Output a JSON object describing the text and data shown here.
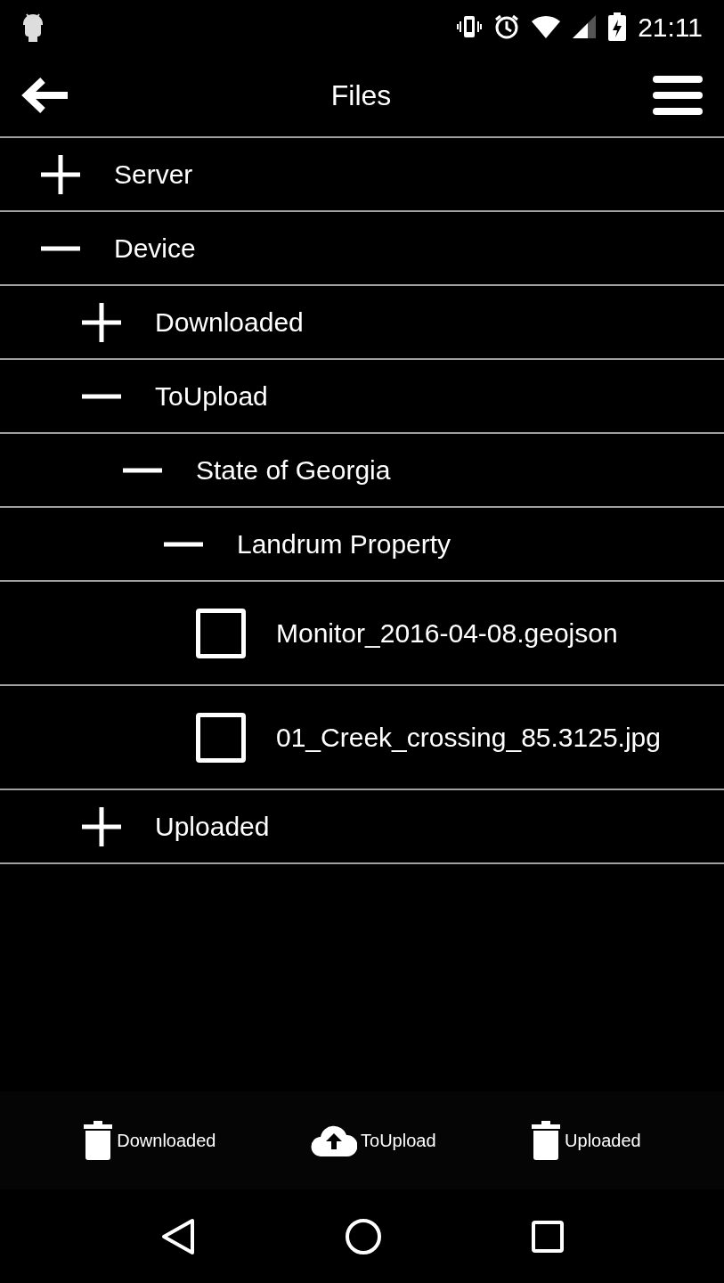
{
  "status_bar": {
    "time": "21:11"
  },
  "app_bar": {
    "title": "Files"
  },
  "tree": [
    {
      "label": "Server",
      "expanded": false
    },
    {
      "label": "Device",
      "expanded": true,
      "children": [
        {
          "label": "Downloaded",
          "expanded": false
        },
        {
          "label": "ToUpload",
          "expanded": true,
          "children": [
            {
              "label": "State of Georgia",
              "expanded": true,
              "children": [
                {
                  "label": "Landrum Property",
                  "expanded": true,
                  "children": [
                    {
                      "kind": "file",
                      "label": "Monitor_2016-04-08.geojson",
                      "checked": false
                    },
                    {
                      "kind": "file",
                      "label": "01_Creek_crossing_85.3125.jpg",
                      "checked": false
                    }
                  ]
                }
              ]
            }
          ]
        },
        {
          "label": "Uploaded",
          "expanded": false
        }
      ]
    }
  ],
  "toolbar": [
    {
      "kind": "delete",
      "label": "Downloaded"
    },
    {
      "kind": "upload",
      "label": "ToUpload"
    },
    {
      "kind": "delete",
      "label": "Uploaded"
    }
  ]
}
